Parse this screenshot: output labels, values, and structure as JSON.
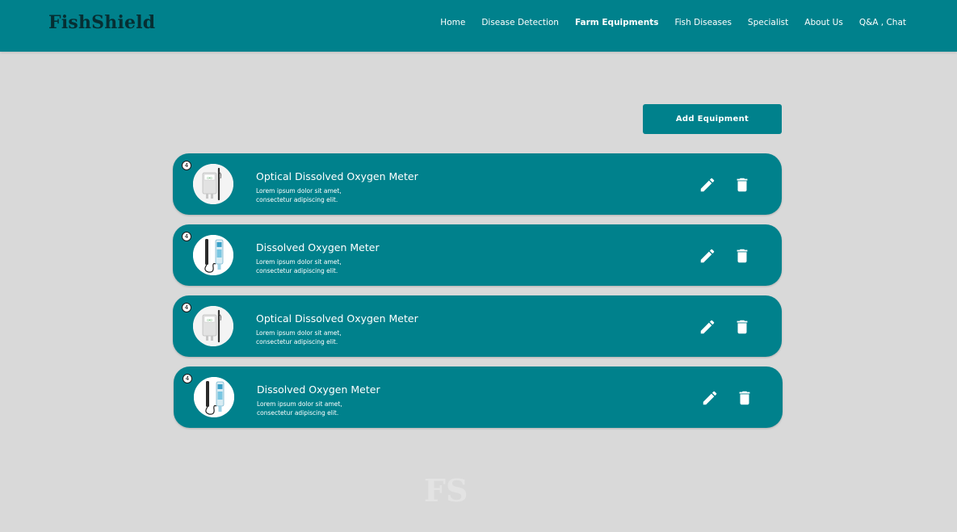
{
  "brand": {
    "logo_text": "FishShield"
  },
  "nav": {
    "items": [
      {
        "label": "Home",
        "active": false
      },
      {
        "label": "Disease Detection",
        "active": false
      },
      {
        "label": "Farm Equipments",
        "active": true
      },
      {
        "label": "Fish Diseases",
        "active": false
      },
      {
        "label": "Specialist",
        "active": false
      },
      {
        "label": "About Us",
        "active": false
      },
      {
        "label": "Q&A , Chat",
        "active": false
      }
    ]
  },
  "actions": {
    "add_label": "Add Equipment"
  },
  "equipment": [
    {
      "badge": "4",
      "title": "Optical Dissolved Oxygen Meter",
      "desc_line1": "Lorem ipsum dolor sit amet,",
      "desc_line2": "consectetur adipiscing elit.",
      "image": "optical-do-meter"
    },
    {
      "badge": "4",
      "title": "Dissolved Oxygen Meter",
      "desc_line1": "Lorem ipsum dolor sit amet,",
      "desc_line2": "consectetur adipiscing elit.",
      "image": "do-meter-pen"
    },
    {
      "badge": "4",
      "title": "Optical Dissolved Oxygen Meter",
      "desc_line1": "Lorem ipsum dolor sit amet,",
      "desc_line2": "consectetur adipiscing elit.",
      "image": "optical-do-meter"
    },
    {
      "badge": "4",
      "title": "Dissolved Oxygen Meter",
      "desc_line1": "Lorem ipsum dolor sit amet,",
      "desc_line2": "consectetur adipiscing elit.",
      "image": "do-meter-pen"
    }
  ],
  "icons": {
    "edit": "pencil-icon",
    "delete": "trash-icon"
  },
  "colors": {
    "primary": "#00818c",
    "background": "#d9d9d9",
    "logo": "#062f33"
  }
}
